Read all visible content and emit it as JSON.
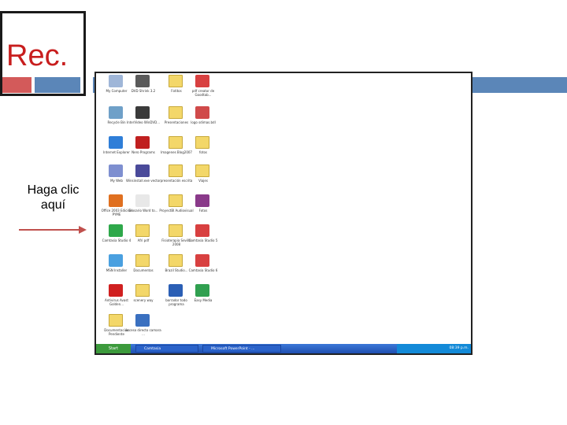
{
  "slide": {
    "title": "Rec.",
    "caption_line1": "Haga clic",
    "caption_line2": "aquí",
    "colors": {
      "title": "#c81e1e",
      "accent_red": "#d35a5a",
      "accent_blue": "#5b86b8",
      "arrow": "#c0504d"
    }
  },
  "desktop": {
    "icons": [
      {
        "label": "My Computer",
        "icon": "computer-icon"
      },
      {
        "label": "DVD Shrink 3.2",
        "icon": "dvd-icon"
      },
      {
        "label": "Fotitos",
        "icon": "folder-icon"
      },
      {
        "label": "pdf creator de Goodtab...",
        "icon": "pdf-icon"
      },
      {
        "label": "Recycle Bin",
        "icon": "recycle-bin-icon"
      },
      {
        "label": "InterVideo WinDVD...",
        "icon": "dvd-player-icon"
      },
      {
        "label": "Presentaciones",
        "icon": "folder-icon"
      },
      {
        "label": "logo sdimas.bdl",
        "icon": "document-icon"
      },
      {
        "label": "Internet Explorer",
        "icon": "internet-explorer-icon"
      },
      {
        "label": "Nero Programs",
        "icon": "nero-icon"
      },
      {
        "label": "Imagenes Blog2007",
        "icon": "folder-icon"
      },
      {
        "label": "fotos",
        "icon": "folder-icon"
      },
      {
        "label": "My Web",
        "icon": "network-icon"
      },
      {
        "label": "Winsinstall.exe vector",
        "icon": "installer-icon"
      },
      {
        "label": "presentación escrita",
        "icon": "folder-icon"
      },
      {
        "label": "Viajes",
        "icon": "folder-icon"
      },
      {
        "label": "Office 2003 Edición PYME",
        "icon": "office-icon"
      },
      {
        "label": "Glosario Word to...",
        "icon": "text-file-icon"
      },
      {
        "label": "ProyectBI Audiovisual",
        "icon": "folder-icon"
      },
      {
        "label": "Fotos",
        "icon": "winrar-icon"
      },
      {
        "label": "Camtasia Studio 4",
        "icon": "camtasia-icon"
      },
      {
        "label": "Afri pdf",
        "icon": "folder-icon"
      },
      {
        "label": "Fisioterapia Sevilla 2008",
        "icon": "folder-icon"
      },
      {
        "label": "Camtasia Studio 5",
        "icon": "pdf-icon"
      },
      {
        "label": "MSN Installer",
        "icon": "msn-icon"
      },
      {
        "label": "Documentos",
        "icon": "folder-icon"
      },
      {
        "label": "Brazil Studio...",
        "icon": "folder-icon"
      },
      {
        "label": "Camtasia Studio 6",
        "icon": "pdf-icon"
      },
      {
        "label": "Antivirus Avast Golden...",
        "icon": "antivirus-icon"
      },
      {
        "label": "scenery way",
        "icon": "folder-icon"
      },
      {
        "label": "borrador todo programa",
        "icon": "word-doc-icon"
      },
      {
        "label": "Easy Media",
        "icon": "media-icon"
      },
      {
        "label": "Documentación Pendiente",
        "icon": "folder-icon"
      },
      {
        "label": "acceso directo camara ...",
        "icon": "shortcut-icon"
      }
    ]
  },
  "taskbar": {
    "start_label": "Start",
    "items": [
      "Camtasia",
      "Microsoft PowerPoint - ..."
    ],
    "clock": "08:39 p.m."
  }
}
